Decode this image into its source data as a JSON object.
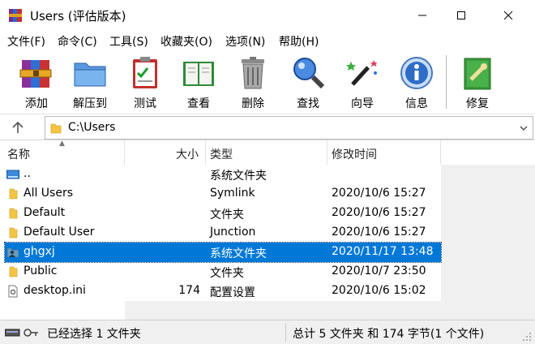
{
  "window": {
    "title": "Users (评估版本)"
  },
  "menu": [
    "文件(F)",
    "命令(C)",
    "工具(S)",
    "收藏夹(O)",
    "选项(N)",
    "帮助(H)"
  ],
  "toolbar": {
    "add": "添加",
    "extract": "解压到",
    "test": "测试",
    "view": "查看",
    "delete": "删除",
    "find": "查找",
    "wizard": "向导",
    "info": "信息",
    "repair": "修复"
  },
  "address": {
    "path": "C:\\Users"
  },
  "columns": {
    "name": "名称",
    "size": "大小",
    "type": "类型",
    "modified": "修改时间"
  },
  "files": [
    {
      "name": "..",
      "size": "",
      "type": "系统文件夹",
      "modified": "",
      "icon": "parent-drive-icon"
    },
    {
      "name": "All Users",
      "size": "",
      "type": "Symlink",
      "modified": "2020/10/6 15:27",
      "icon": "folder-icon"
    },
    {
      "name": "Default",
      "size": "",
      "type": "文件夹",
      "modified": "2020/10/6 15:27",
      "icon": "folder-icon"
    },
    {
      "name": "Default User",
      "size": "",
      "type": "Junction",
      "modified": "2020/10/6 15:27",
      "icon": "folder-icon"
    },
    {
      "name": "ghgxj",
      "size": "",
      "type": "系统文件夹",
      "modified": "2020/11/17 13:48",
      "icon": "user-folder-icon",
      "selected": true
    },
    {
      "name": "Public",
      "size": "",
      "type": "文件夹",
      "modified": "2020/10/7 23:50",
      "icon": "folder-icon"
    },
    {
      "name": "desktop.ini",
      "size": "174",
      "type": "配置设置",
      "modified": "2020/10/6 15:02",
      "icon": "settings-file-icon"
    }
  ],
  "status": {
    "left": "已经选择 1 文件夹",
    "right": "总计 5 文件夹 和 174 字节(1 个文件)"
  },
  "colors": {
    "selection": "#0078d7",
    "folder": "#f4c542"
  }
}
